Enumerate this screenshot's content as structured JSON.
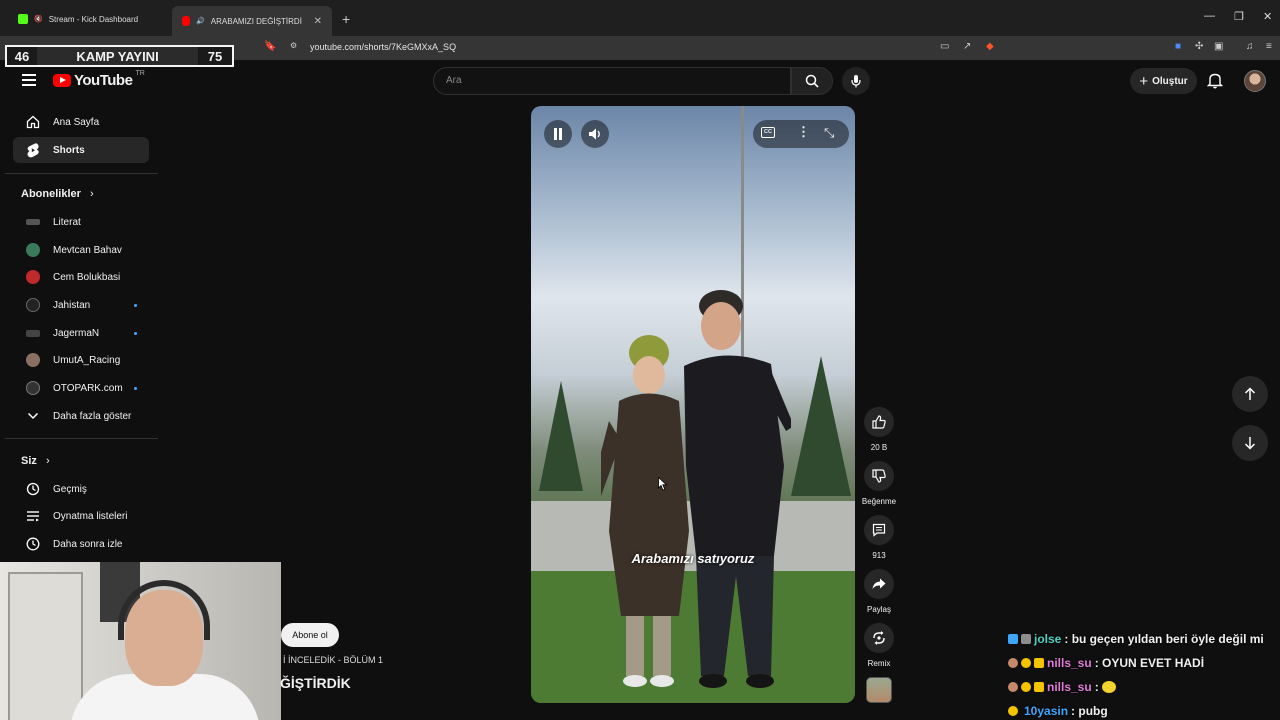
{
  "browser": {
    "tabs": [
      {
        "label": "Stream - Kick Dashboard"
      },
      {
        "label": "ARABAMIZI DEĞİŞTİRDİK - Yo"
      }
    ],
    "url": "youtube.com/shorts/7KeGMXxA_SQ"
  },
  "overlay": {
    "left_score": "46",
    "title": "KAMP YAYINI",
    "right_score": "75"
  },
  "header": {
    "logo_text": "YouTube",
    "region": "TR",
    "search_placeholder": "Ara",
    "create_label": "Oluştur"
  },
  "sidebar": {
    "main": [
      {
        "label": "Ana Sayfa",
        "icon": "home-icon"
      },
      {
        "label": "Shorts",
        "icon": "shorts-icon"
      }
    ],
    "subs_heading": "Abonelikler",
    "subs": [
      {
        "label": "Literat",
        "color": "#555555",
        "dot": false
      },
      {
        "label": "Mevtcan Bahav",
        "color": "#3a7a5a",
        "dot": false
      },
      {
        "label": "Cem Bolukbasi",
        "color": "#c02a2a",
        "dot": false
      },
      {
        "label": "Jahistan",
        "color": "#222222",
        "dot": true
      },
      {
        "label": "JagermaN",
        "color": "#444444",
        "dot": true
      },
      {
        "label": "UmutA_Racing",
        "color": "#8a7060",
        "dot": false
      },
      {
        "label": "OTOPARK.com",
        "color": "#333333",
        "dot": true
      }
    ],
    "show_more": "Daha fazla göster",
    "you_heading": "Siz",
    "you_items": [
      {
        "label": "Geçmiş",
        "icon": "history-icon"
      },
      {
        "label": "Oynatma listeleri",
        "icon": "playlist-icon"
      },
      {
        "label": "Daha sonra izle",
        "icon": "clock-icon"
      }
    ]
  },
  "video": {
    "caption": "Arabamızı satıyoruz"
  },
  "actions": {
    "like_count": "20 B",
    "dislike_label": "Beğenme",
    "comment_count": "913",
    "share_label": "Paylaş",
    "remix_label": "Remix"
  },
  "channel": {
    "subscribe_label": "Abone ol",
    "next_subtitle": "İ İNCELEDİK - BÖLÜM 1",
    "next_title": "ĞİŞTİRDİK"
  },
  "chat": [
    {
      "user": "jolse",
      "user_color": "#4fd0c0",
      "message": ": bu geçen yıldan beri öyle değil mi"
    },
    {
      "user": "nills_su",
      "user_color": "#e07bd8",
      "message": ": OYUN EVET HADİ"
    },
    {
      "user": "nills_su",
      "user_color": "#e07bd8",
      "message": ":"
    },
    {
      "user": "10yasin",
      "user_color": "#3ea6ff",
      "message": ": pubg"
    }
  ]
}
